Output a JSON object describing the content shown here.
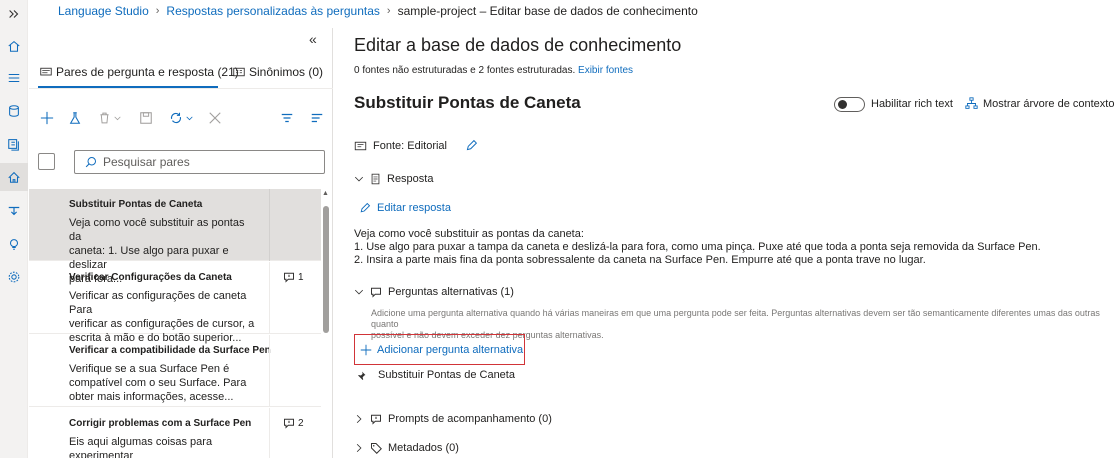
{
  "breadcrumb": {
    "root": "Language Studio",
    "section": "Respostas personalizadas às perguntas",
    "current": "sample-project – Editar base de dados de conhecimento"
  },
  "left_pane": {
    "collapse_glyph": "«",
    "tabs": [
      {
        "label": "Pares de pergunta e resposta (21)",
        "icon": "qna-pairs-icon"
      },
      {
        "label": "Sinônimos (0)",
        "icon": "synonyms-icon"
      }
    ],
    "search_placeholder": "Pesquisar pares",
    "items": [
      {
        "title": "Substituir Pontas de Caneta",
        "lines": [
          "Veja como você substituir as pontas da",
          "caneta: 1. Use algo para puxar e deslizar",
          "para fora..."
        ],
        "badge": ""
      },
      {
        "title": "Verificar Configurações da Caneta",
        "lines": [
          "Verificar as configurações de caneta Para",
          "verificar as configurações de cursor, a",
          "escrita à mão e do botão superior..."
        ],
        "badge": "1"
      },
      {
        "title": "Verificar a compatibilidade da Surface Pen",
        "lines": [
          "Verifique se a sua Surface Pen é",
          "compatível com o seu Surface. Para",
          "obter mais informações, acesse..."
        ],
        "badge": ""
      },
      {
        "title": "Corrigir problemas com a Surface Pen",
        "lines": [
          "Eis aqui algumas coisas para experimentar"
        ],
        "badge": "2"
      }
    ]
  },
  "main": {
    "title": "Editar a base de dados de conhecimento",
    "sources_text": "0 fontes não estruturadas e 2 fontes estruturadas.",
    "sources_link": "Exibir fontes",
    "qna_title": "Substituir Pontas de Caneta",
    "rich_text_label": "Habilitar rich text",
    "rich_text_on": false,
    "context_tree_label": "Mostrar árvore de contexto",
    "source_label": "Fonte: Editorial",
    "answer_section": "Resposta",
    "edit_answer": "Editar resposta",
    "answer_lines": [
      "Veja como você substituir as pontas da caneta:",
      "1. Use algo para puxar a tampa da caneta e deslizá-la para fora, como uma pinça. Puxe até que toda a ponta seja removida da Surface Pen.",
      "2. Insira a parte mais fina da ponta sobressalente da caneta na Surface Pen. Empurre até que a ponta trave no lugar."
    ],
    "alt_section": "Perguntas alternativas (1)",
    "alt_help_1": "Adicione uma pergunta alternativa quando há várias maneiras em que uma pergunta pode ser feita. Perguntas alternativas devem ser tão semanticamente diferentes umas das outras quanto",
    "alt_help_2": "possível e não devem exceder dez perguntas alternativas.",
    "add_alt": "Adicionar pergunta alternativa",
    "alt_questions": [
      "Substituir Pontas de Caneta"
    ],
    "followup_section": "Prompts de acompanhamento (0)",
    "metadata_section": "Metadados (0)"
  },
  "colors": {
    "accent": "#0f6cbd",
    "highlight_border": "#d13438",
    "selected_row": "#e1dfdd"
  }
}
